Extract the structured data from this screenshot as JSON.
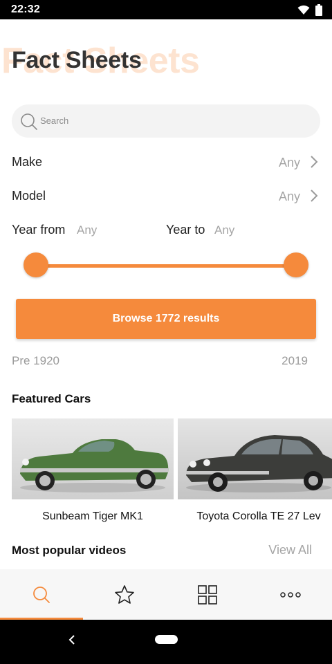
{
  "status_bar": {
    "time": "22:32"
  },
  "header": {
    "title": "Fact Sheets",
    "ghost_title": "Fact Sheets"
  },
  "search": {
    "placeholder": "Search"
  },
  "filters": {
    "make": {
      "label": "Make",
      "value": "Any"
    },
    "model": {
      "label": "Model",
      "value": "Any"
    },
    "year_from": {
      "label": "Year from",
      "value": "Any"
    },
    "year_to": {
      "label": "Year to",
      "value": "Any"
    }
  },
  "year_slider": {
    "min_label": "Pre 1920",
    "max_label": "2019",
    "low_position": 0.0,
    "high_position": 1.0
  },
  "browse_button": {
    "label": "Browse 1772 results"
  },
  "featured": {
    "title": "Featured Cars",
    "cars": [
      {
        "name": "Sunbeam Tiger MK1",
        "body_color": "#4e7a3e"
      },
      {
        "name": "Toyota Corolla TE 27 Lev",
        "body_color": "#3c3d3a"
      }
    ]
  },
  "videos": {
    "title": "Most popular videos",
    "view_all": "View All"
  },
  "tabs": [
    {
      "name": "search",
      "icon": "search-icon",
      "active": true
    },
    {
      "name": "favourites",
      "icon": "star-icon",
      "active": false
    },
    {
      "name": "grid",
      "icon": "grid-icon",
      "active": false
    },
    {
      "name": "more",
      "icon": "more-icon",
      "active": false
    }
  ],
  "colors": {
    "accent": "#f58a3c",
    "ghost_title": "#fde3d0",
    "muted_text": "#a5a5a5"
  }
}
